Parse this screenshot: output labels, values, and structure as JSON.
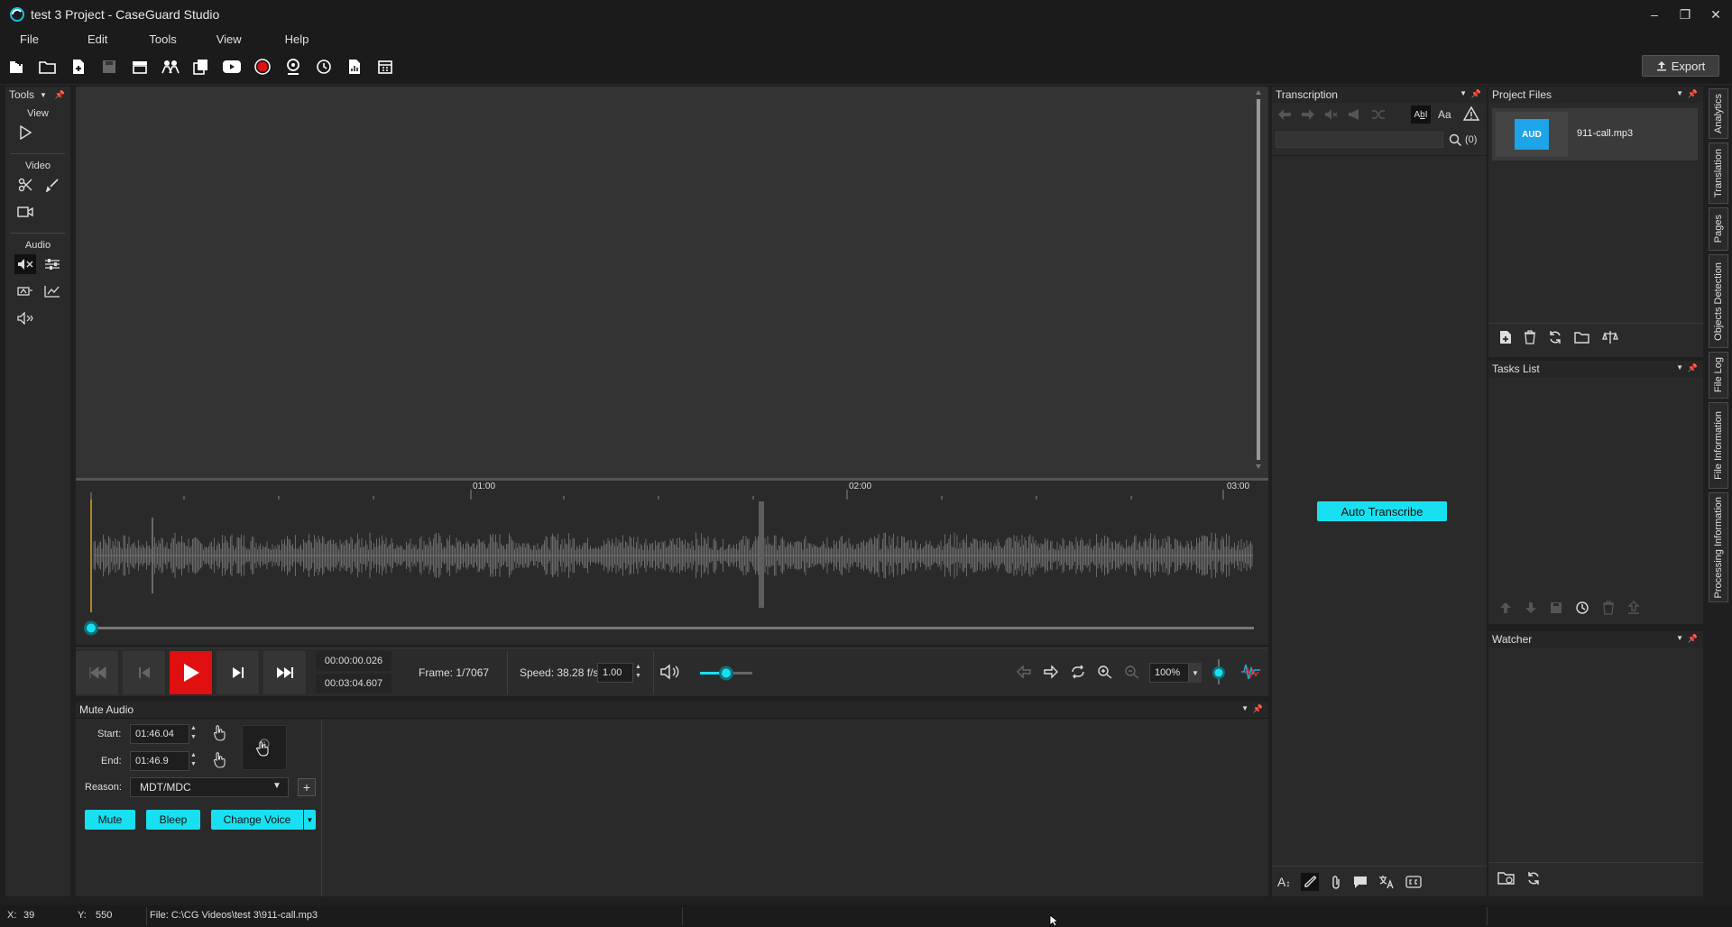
{
  "window": {
    "title": "test 3 Project - CaseGuard Studio",
    "controls": [
      "minimize",
      "restore",
      "close"
    ]
  },
  "menu": [
    "File",
    "Edit",
    "Tools",
    "View",
    "Help"
  ],
  "toolbar": {
    "icons": [
      "new-project-icon",
      "open-folder-icon",
      "add-file-icon",
      "save-icon",
      "archive-icon",
      "people-icon",
      "duplicate-icon",
      "youtube-icon",
      "record-icon",
      "webcam-icon",
      "history-icon",
      "report-icon",
      "calendar-icon"
    ],
    "export_label": "Export"
  },
  "tools_panel": {
    "title": "Tools",
    "sections": {
      "view": "View",
      "video": "Video",
      "audio": "Audio"
    }
  },
  "timeline": {
    "ticks": [
      "01:00",
      "02:00",
      "03:00"
    ]
  },
  "transport": {
    "current_time": "00:00:00.026",
    "total_time": "00:03:04.607",
    "frame": "Frame: 1/7067",
    "speed_label": "Speed: 38.28 f/s",
    "speed_value": "1.00",
    "volume_level": 0.5,
    "zoom": "100%"
  },
  "mute_audio": {
    "title": "Mute Audio",
    "start_label": "Start:",
    "start_value": "01:46.04",
    "end_label": "End:",
    "end_value": "01:46.9",
    "reason_label": "Reason:",
    "reason_value": "MDT/MDC",
    "mute_label": "Mute",
    "bleep_label": "Bleep",
    "change_voice_label": "Change Voice"
  },
  "transcription": {
    "title": "Transcription",
    "search_count": "(0)",
    "auto_transcribe_label": "Auto Transcribe",
    "case_toggle": "Aa"
  },
  "project_files": {
    "title": "Project Files",
    "files": [
      {
        "name": "911-call.mp3",
        "thumb_text": "AUD"
      }
    ]
  },
  "tasks": {
    "title": "Tasks List"
  },
  "watcher": {
    "title": "Watcher"
  },
  "side_tabs": [
    "Analytics",
    "Translation",
    "Pages",
    "Objects Detection",
    "File Log",
    "File Information",
    "Processing Information"
  ],
  "status": {
    "x_label": "X:",
    "x_value": "39",
    "y_label": "Y:",
    "y_value": "550",
    "file": "File: C:\\CG Videos\\test 3\\911-call.mp3"
  },
  "colors": {
    "accent": "#18e0f0",
    "play": "#e01010",
    "panel": "#2a2a2a",
    "background": "#1f1f1f"
  }
}
